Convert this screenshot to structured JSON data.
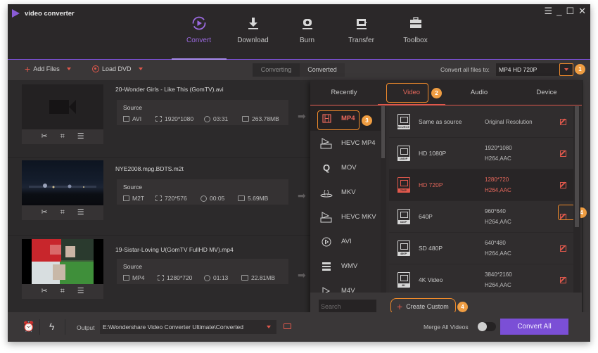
{
  "app": {
    "title": "video converter",
    "window_controls": {
      "menu": "☰",
      "minimize": "_",
      "maximize": "☐",
      "close": "✕"
    }
  },
  "nav": {
    "active": "Convert",
    "items": [
      {
        "label": "Convert",
        "icon": "convert-icon"
      },
      {
        "label": "Download",
        "icon": "download-icon"
      },
      {
        "label": "Burn",
        "icon": "burn-icon"
      },
      {
        "label": "Transfer",
        "icon": "transfer-icon"
      },
      {
        "label": "Toolbox",
        "icon": "toolbox-icon"
      }
    ]
  },
  "toolbar": {
    "add_files": "Add Files",
    "load_dvd": "Load DVD",
    "tabs": [
      "Converting",
      "Converted"
    ],
    "active_tab": "Converted",
    "convert_all_label": "Convert all files to:",
    "convert_all_value": "MP4 HD 720P"
  },
  "files": [
    {
      "name": "20-Wonder Girls - Like This (GomTV).avi",
      "source_label": "Source",
      "format": "AVI",
      "resolution": "1920*1080",
      "duration": "03:31",
      "size": "263.78MB",
      "thumbnail": "placeholder"
    },
    {
      "name": "NYE2008.mpg.BDTS.m2t",
      "source_label": "Source",
      "format": "M2T",
      "resolution": "720*576",
      "duration": "00:05",
      "size": "5.69MB",
      "thumbnail": "night-city"
    },
    {
      "name": "19-Sistar-Loving U(GomTV FullHD MV).mp4",
      "source_label": "Source",
      "format": "MP4",
      "resolution": "1280*720",
      "duration": "01:13",
      "size": "22.81MB",
      "thumbnail": "music-video"
    }
  ],
  "format_panel": {
    "tabs": [
      "Recently",
      "Video",
      "Audio",
      "Device"
    ],
    "active_tab": "Video",
    "formats": [
      "MP4",
      "HEVC MP4",
      "MOV",
      "MKV",
      "HEVC MKV",
      "AVI",
      "WMV",
      "M4V"
    ],
    "active_format": "MP4",
    "presets": [
      {
        "name": "Same as source",
        "spec1": "Original Resolution",
        "spec2": "",
        "tag": "SOURCE"
      },
      {
        "name": "HD 1080P",
        "spec1": "1920*1080",
        "spec2": "H264,AAC",
        "tag": "1080P"
      },
      {
        "name": "HD 720P",
        "spec1": "1280*720",
        "spec2": "H264,AAC",
        "tag": "720P"
      },
      {
        "name": "640P",
        "spec1": "960*640",
        "spec2": "H264,AAC",
        "tag": "640P"
      },
      {
        "name": "SD 480P",
        "spec1": "640*480",
        "spec2": "H264,AAC",
        "tag": "480P"
      },
      {
        "name": "4K Video",
        "spec1": "3840*2160",
        "spec2": "H264,AAC",
        "tag": "4K"
      }
    ],
    "active_preset": "HD 720P",
    "search_placeholder": "Search",
    "create_custom": "Create Custom"
  },
  "badges": {
    "step1": "1",
    "step2": "2",
    "step3": "3",
    "step4a": "4",
    "step4b": "4"
  },
  "bottom": {
    "output_label": "Output",
    "output_path": "E:\\Wondershare Video Converter Ultimate\\Converted",
    "merge_label": "Merge All Videos",
    "merge_enabled": false,
    "convert_all": "Convert All"
  },
  "colors": {
    "accent_purple": "#7b4fd6",
    "accent_red": "#e0584c",
    "highlight_orange": "#ef8a2b",
    "badge_orange": "#ef9d42"
  }
}
